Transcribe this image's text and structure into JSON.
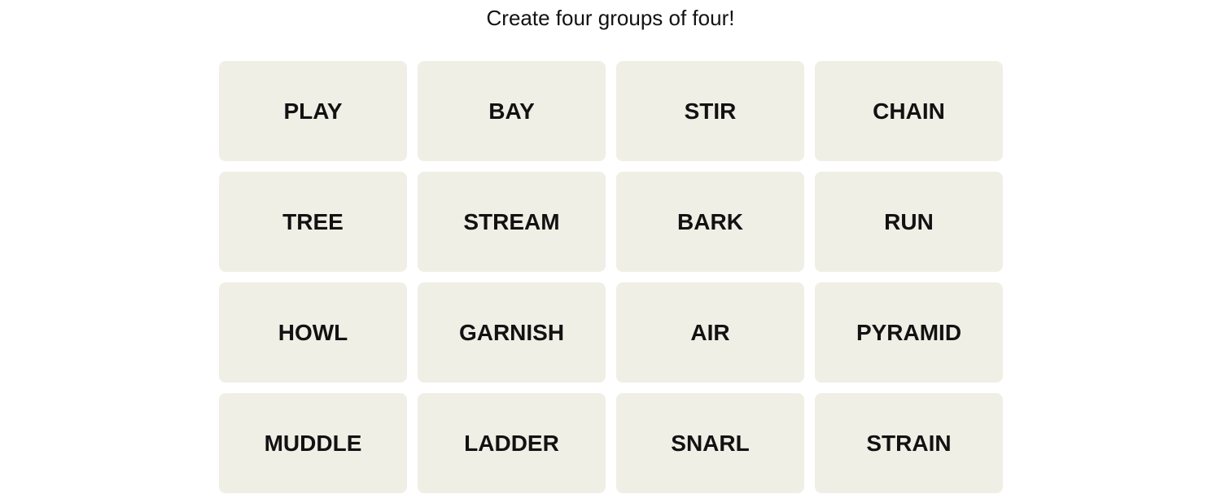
{
  "header": {
    "subtitle": "Create four groups of four!"
  },
  "board": {
    "tiles": [
      "PLAY",
      "BAY",
      "STIR",
      "CHAIN",
      "TREE",
      "STREAM",
      "BARK",
      "RUN",
      "HOWL",
      "GARNISH",
      "AIR",
      "PYRAMID",
      "MUDDLE",
      "LADDER",
      "SNARL",
      "STRAIN"
    ]
  },
  "colors": {
    "tile_background": "#efefe6",
    "tile_text": "#121212"
  }
}
